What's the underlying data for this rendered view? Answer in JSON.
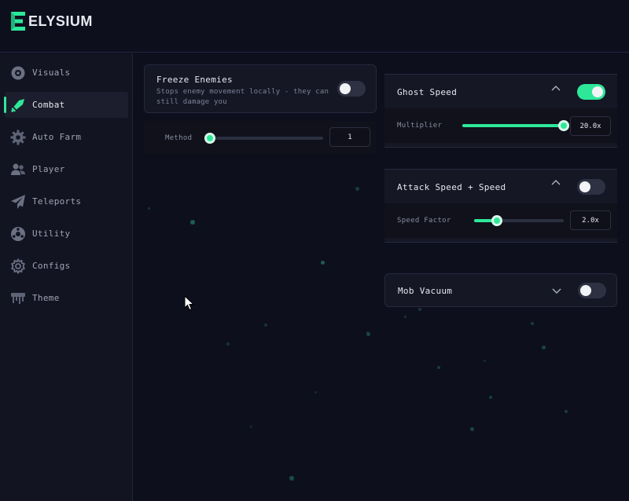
{
  "app": {
    "logo_text": "ELYSIUM",
    "accent": "#2ee89a"
  },
  "sidebar": {
    "items": [
      {
        "label": "Visuals",
        "icon": "eye-icon",
        "active": false
      },
      {
        "label": "Combat",
        "icon": "sword-icon",
        "active": true
      },
      {
        "label": "Auto Farm",
        "icon": "gear-icon",
        "active": false
      },
      {
        "label": "Player",
        "icon": "users-icon",
        "active": false
      },
      {
        "label": "Teleports",
        "icon": "paper-plane-icon",
        "active": false
      },
      {
        "label": "Utility",
        "icon": "settings-circle-icon",
        "active": false
      },
      {
        "label": "Configs",
        "icon": "cog-icon",
        "active": false
      },
      {
        "label": "Theme",
        "icon": "paint-roller-icon",
        "active": false
      }
    ]
  },
  "freeze": {
    "title": "Freeze Enemies",
    "description_line1": "Stops enemy movement locally - they can",
    "description_line2": "still damage you",
    "enabled": false,
    "method_label": "Method",
    "method_value": "1",
    "method_slider_fraction": 0
  },
  "ghost": {
    "title": "Ghost Speed",
    "enabled": true,
    "expanded": true,
    "multiplier_label": "Multiplier",
    "multiplier_value": "20.0x",
    "multiplier_slider_fraction": 1.0
  },
  "attack": {
    "title": "Attack Speed + Speed",
    "enabled": false,
    "expanded": true,
    "factor_label": "Speed Factor",
    "factor_value": "2.0x",
    "factor_slider_fraction": 0.25
  },
  "vacuum": {
    "title": "Mob Vacuum",
    "enabled": false,
    "expanded": false
  }
}
